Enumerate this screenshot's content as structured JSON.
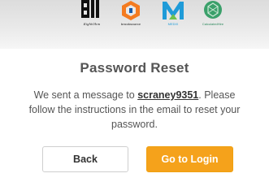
{
  "logos": [
    {
      "icon": "eight-bit-logo",
      "caption": "EightOhm"
    },
    {
      "icon": "brooksource-logo",
      "caption": "brooksource"
    },
    {
      "icon": "medix-logo",
      "caption": "MEDIX"
    },
    {
      "icon": "calculated-hire-logo",
      "caption": "CalculatedHire"
    }
  ],
  "title": "Password Reset",
  "message": {
    "before": "We sent a message to ",
    "username": "scraney9351",
    "after": ". Please follow the instructions in the email to reset your password."
  },
  "buttons": {
    "back": "Back",
    "login": "Go to Login"
  },
  "colors": {
    "accent": "#f5a21b",
    "brooksource": "#f47b20",
    "medix": "#1f9bd8",
    "calculated_hire": "#3aa06a"
  }
}
